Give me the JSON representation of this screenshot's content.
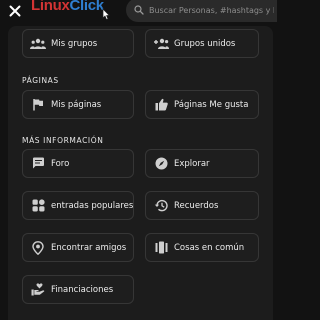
{
  "header": {
    "logo_part1": "Linux",
    "logo_part2": "Click",
    "search_placeholder": "Buscar Personas, #hashtags y Pa"
  },
  "groups": {
    "my_groups": "Mis grupos",
    "joined_groups": "Grupos unidos"
  },
  "pages_section": {
    "title": "PÁGINAS",
    "my_pages": "Mis páginas",
    "liked_pages": "Páginas Me gusta"
  },
  "more_section": {
    "title": "MÁS INFORMACIÓN",
    "forum": "Foro",
    "explore": "Explorar",
    "popular_posts": "entradas populares",
    "memories": "Recuerdos",
    "find_friends": "Encontrar amigos",
    "common_things": "Cosas en común",
    "funding": "Financiaciones"
  },
  "colors": {
    "logo_red": "#d23434",
    "logo_blue": "#2f7fd1",
    "background": "#121212",
    "card_border": "#363636"
  }
}
